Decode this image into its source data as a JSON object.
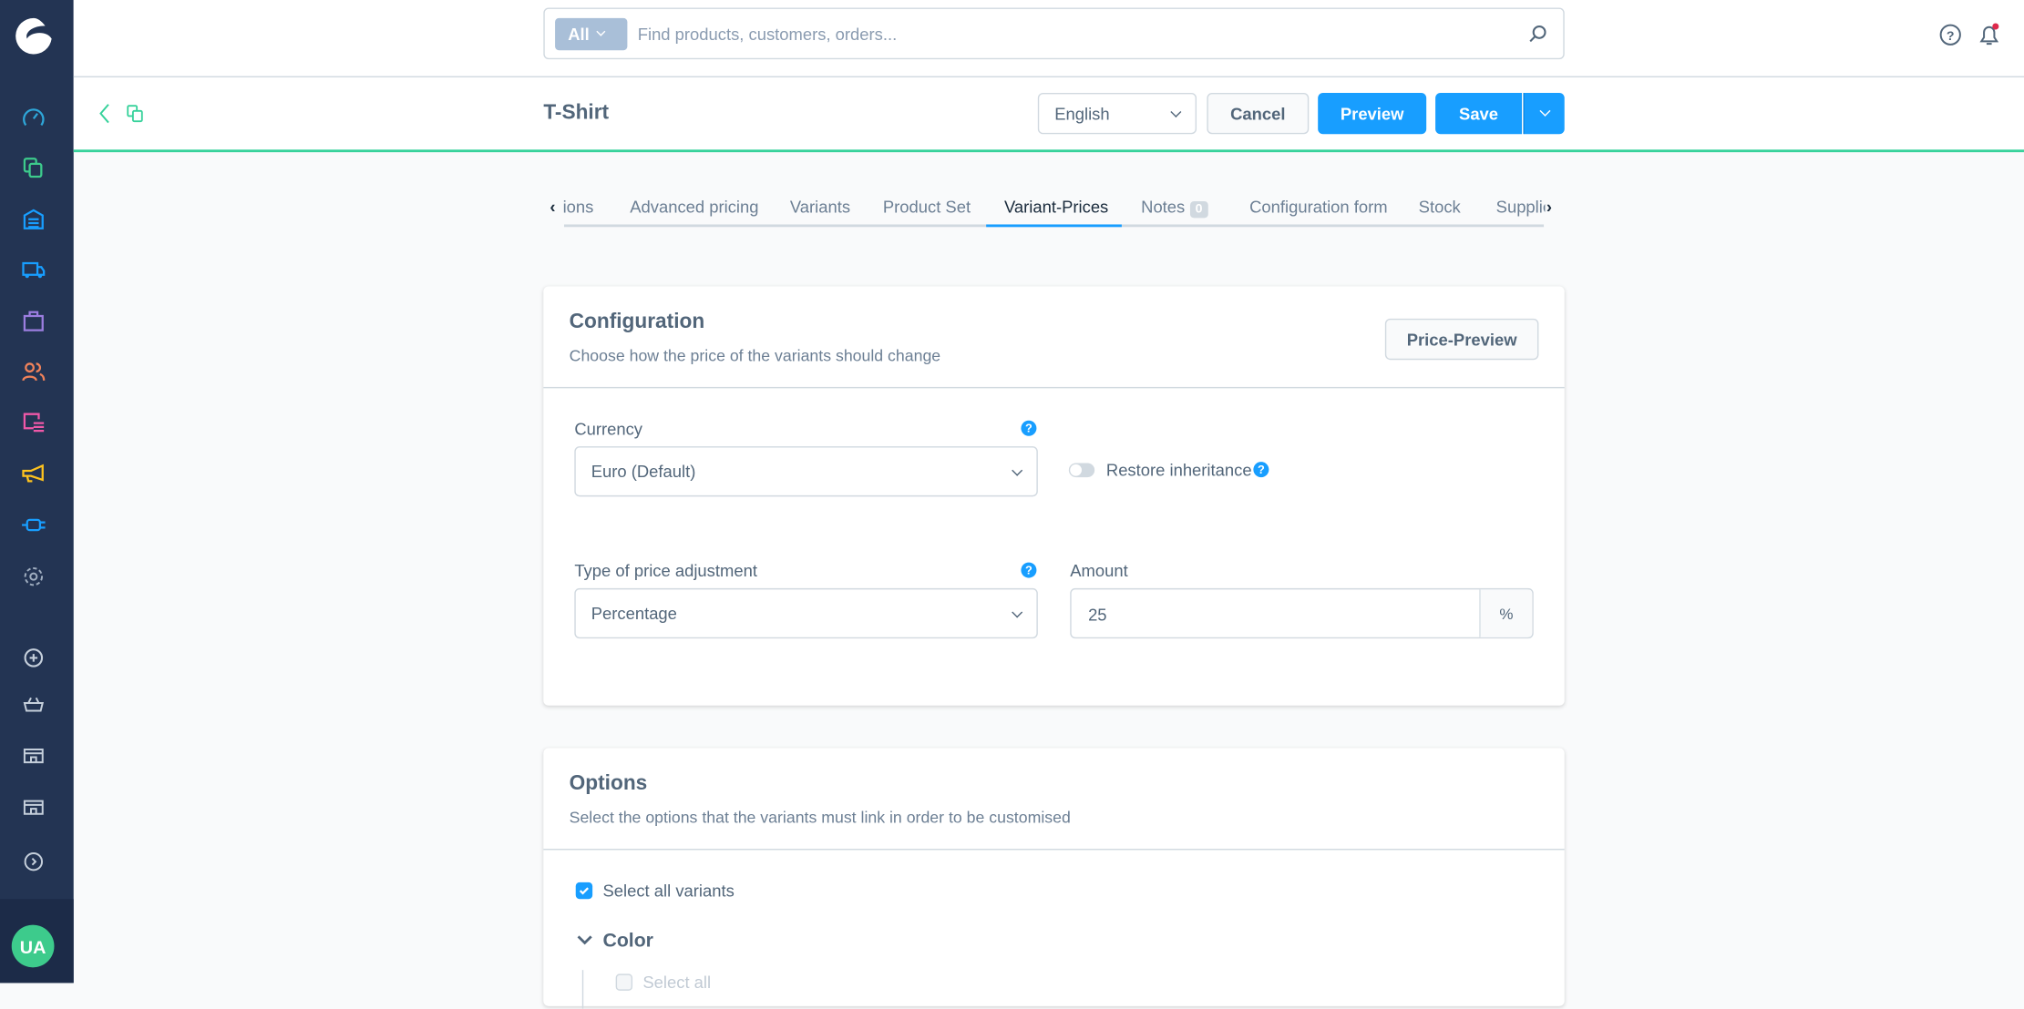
{
  "search": {
    "scope": "All",
    "placeholder": "Find products, customers, orders..."
  },
  "header": {
    "title": "T-Shirt",
    "language": "English",
    "cancel": "Cancel",
    "preview": "Preview",
    "save": "Save"
  },
  "sidebar": {
    "avatar": "UA",
    "icons": [
      "dashboard-icon",
      "catalogue-icon",
      "inventory-icon",
      "orders-icon",
      "shopping-bag-icon",
      "customers-icon",
      "content-icon",
      "marketing-icon",
      "extensions-icon",
      "settings-icon"
    ],
    "bottom_icons": [
      "add-icon",
      "basket-icon",
      "storefront-icon",
      "storefront-icon",
      "expand-icon"
    ]
  },
  "tabs": [
    {
      "label": "ions"
    },
    {
      "label": "Advanced pricing"
    },
    {
      "label": "Variants"
    },
    {
      "label": "Product Set"
    },
    {
      "label": "Variant-Prices",
      "active": true
    },
    {
      "label": "Notes",
      "badge": "0"
    },
    {
      "label": "Configuration form"
    },
    {
      "label": "Stock"
    },
    {
      "label": "Supplie"
    }
  ],
  "configuration": {
    "title": "Configuration",
    "subtitle": "Choose how the price of the variants should change",
    "price_preview": "Price-Preview",
    "currency_label": "Currency",
    "currency_value": "Euro (Default)",
    "restore_inheritance": "Restore inheritance",
    "restore_on": false,
    "type_label": "Type of price adjustment",
    "type_value": "Percentage",
    "amount_label": "Amount",
    "amount_value": "25",
    "amount_suffix": "%"
  },
  "options": {
    "title": "Options",
    "subtitle": "Select the options that the variants must link in order to be customised",
    "select_all_variants": "Select all variants",
    "select_all_checked": true,
    "group": "Color",
    "select_all": "Select all"
  },
  "colors": {
    "accent": "#189eff",
    "brand_green": "#37d29b",
    "sidebar": "#233453"
  }
}
